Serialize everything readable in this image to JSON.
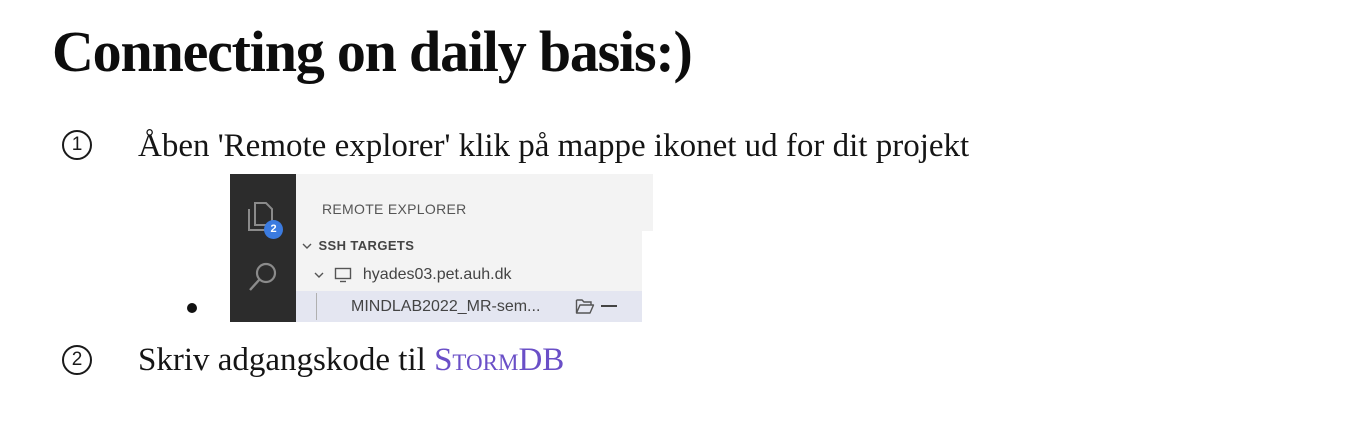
{
  "heading": "Connecting on daily basis:)",
  "steps": [
    {
      "marker": "1",
      "text": "Åben 'Remote explorer' klik på mappe ikonet ud for dit projekt"
    },
    {
      "marker": "2",
      "text_before": "Skriv adgangskode til ",
      "link_text": "StormDB"
    }
  ],
  "screenshot": {
    "panel_title": "REMOTE EXPLORER",
    "badge_count": "2",
    "section_label": "SSH TARGETS",
    "host": "hyades03.pet.auh.dk",
    "folder": "MINDLAB2022_MR-sem...",
    "icons": [
      "files-icon",
      "search-icon",
      "monitor-icon",
      "folder-open-icon",
      "minus-icon",
      "chevron-down-icon"
    ]
  },
  "colors": {
    "link": "#6a4fc7",
    "activity_bar": "#2c2c2c",
    "badge": "#3b7be0",
    "selected_row": "#e4e6f1"
  }
}
